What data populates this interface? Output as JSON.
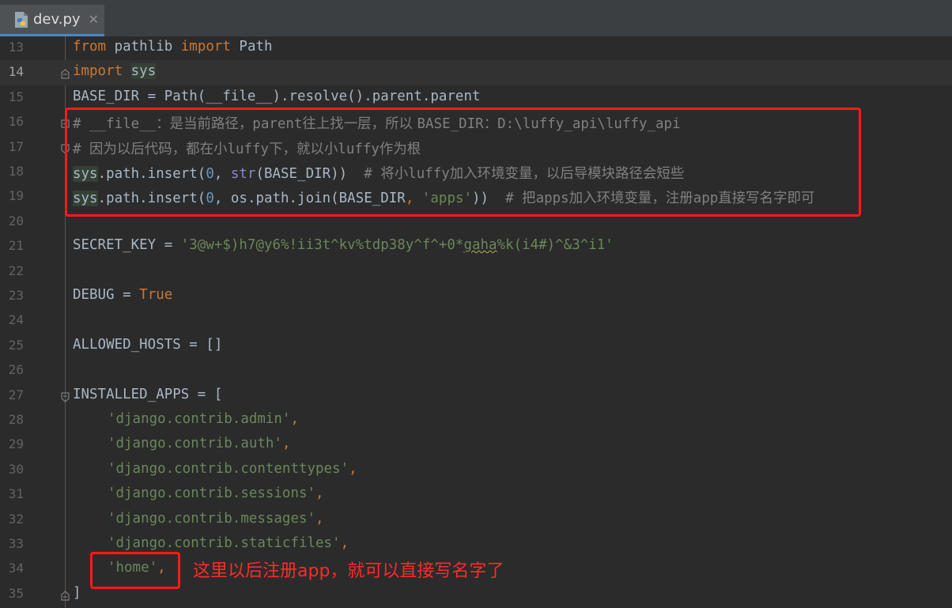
{
  "tab": {
    "label": "dev.py",
    "close": "✕",
    "icon": "python-file-icon"
  },
  "annotation": "这里以后注册app，就可以直接写名字了",
  "colors": {
    "keyword": "#cc7832",
    "string": "#6a8759",
    "number": "#6897bb",
    "comment": "#808080",
    "builtin": "#8888c6",
    "text": "#a9b7c6",
    "annotation_red": "#ff1a1a",
    "background": "#2b2b2b"
  },
  "lines": [
    {
      "n": "13"
    },
    {
      "n": "14"
    },
    {
      "n": "15"
    },
    {
      "n": "16"
    },
    {
      "n": "17"
    },
    {
      "n": "18"
    },
    {
      "n": "19"
    },
    {
      "n": "20"
    },
    {
      "n": "21"
    },
    {
      "n": "22"
    },
    {
      "n": "23"
    },
    {
      "n": "24"
    },
    {
      "n": "25"
    },
    {
      "n": "26"
    },
    {
      "n": "27"
    },
    {
      "n": "28"
    },
    {
      "n": "29"
    },
    {
      "n": "30"
    },
    {
      "n": "31"
    },
    {
      "n": "32"
    },
    {
      "n": "33"
    },
    {
      "n": "34"
    },
    {
      "n": "35"
    }
  ],
  "code": {
    "l13": {
      "kw1": "from",
      "t1": " pathlib ",
      "kw2": "import",
      "t2": " Path"
    },
    "l14": {
      "kw1": "import",
      "t1": " ",
      "t2": "sys"
    },
    "l15": {
      "t1": "BASE_DIR = Path(__file__).resolve().parent.parent"
    },
    "l16": {
      "c1": "# __file__",
      "c2": "：是当前路径，",
      "c3": "parent",
      "c4": "往上找一层，所以 ",
      "c5": "BASE_DIR",
      "c6": "：",
      "c7": "D:\\luffy_api\\luffy_api"
    },
    "l17": {
      "c1": "# ",
      "c2": "因为以后代码，都在小",
      "c3": "luffy",
      "c4": "下，就以小",
      "c5": "luffy",
      "c6": "作为根"
    },
    "l18": {
      "t1": "sys",
      "t2": ".path.insert(",
      "n1": "0",
      "t3": ", ",
      "b1": "str",
      "t4": "(BASE_DIR))  ",
      "c1": "# ",
      "c2": "将小",
      "c3": "luffy",
      "c4": "加入环境变量，以后导模块路径会短些"
    },
    "l19": {
      "t1": "sys",
      "t2": ".path.insert(",
      "n1": "0",
      "t3": ", os.path.join(BASE_DIR",
      "k1": ",",
      "t4": " ",
      "s1": "'apps'",
      "t5": "))  ",
      "c1": "# ",
      "c2": "把",
      "c3": "apps",
      "c4": "加入环境变量，注册",
      "c5": "app",
      "c6": "直接写名字即可"
    },
    "l21": {
      "t1": "SECRET_KEY = ",
      "s1": "'3@w+$)h7@y6%!ii3t^kv%tdp38y^f^+0*",
      "s2": "gaha",
      "s3": "%k(i4#)^&3^i1'"
    },
    "l23": {
      "t1": "DEBUG = ",
      "kw1": "True"
    },
    "l25": {
      "t1": "ALLOWED_HOSTS = []"
    },
    "l27": {
      "t1": "INSTALLED_APPS = ["
    },
    "l28": {
      "s1": "'django.contrib.admin'",
      "k1": ","
    },
    "l29": {
      "s1": "'django.contrib.auth'",
      "k1": ","
    },
    "l30": {
      "s1": "'django.contrib.contenttypes'",
      "k1": ","
    },
    "l31": {
      "s1": "'django.contrib.sessions'",
      "k1": ","
    },
    "l32": {
      "s1": "'django.contrib.messages'",
      "k1": ","
    },
    "l33": {
      "s1": "'django.contrib.staticfiles'",
      "k1": ","
    },
    "l34": {
      "s1": "'home'",
      "k1": ","
    },
    "l35": {
      "t1": "]"
    }
  }
}
